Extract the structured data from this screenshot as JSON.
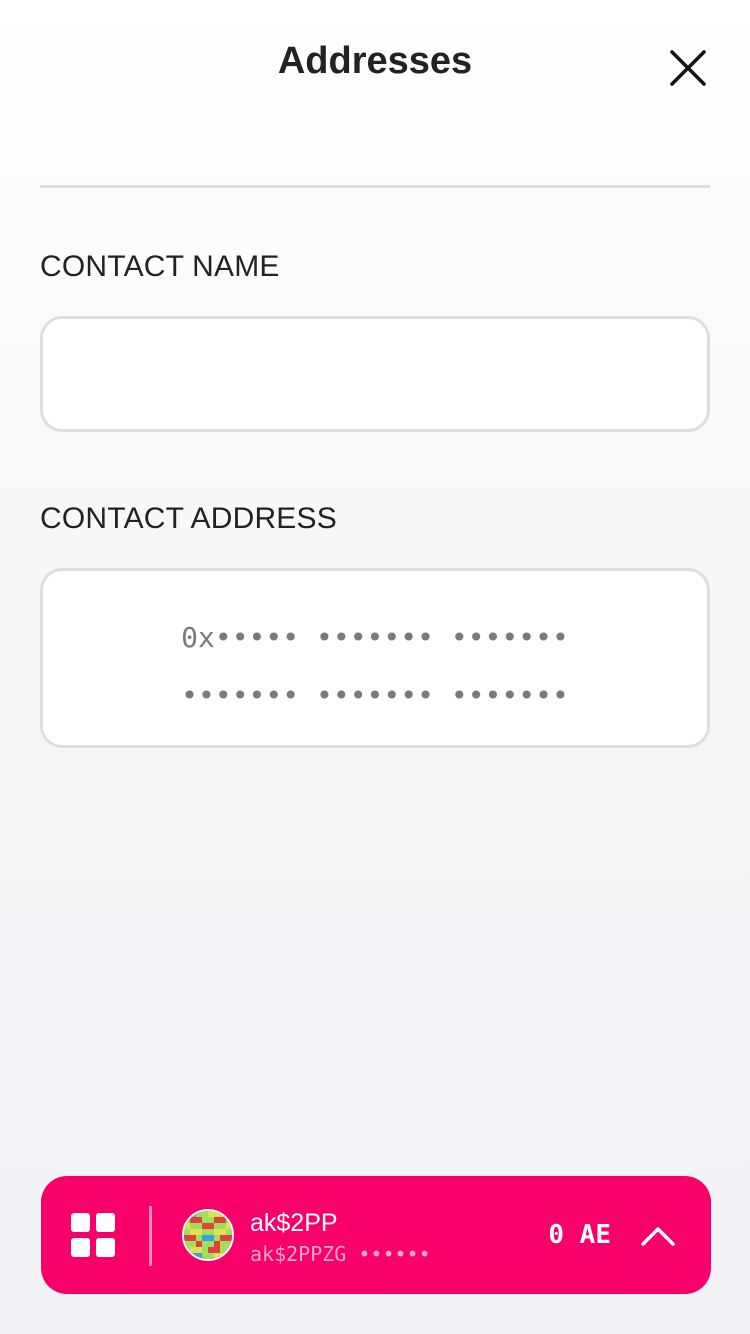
{
  "header": {
    "title": "Addresses",
    "close_icon": "close-icon"
  },
  "form": {
    "name_label": "CONTACT NAME",
    "name_value": "",
    "address_label": "CONTACT ADDRESS",
    "address_placeholder_line1": "0x••••• ••••••• •••••••",
    "address_placeholder_line2": "••••••• ••••••• •••••••"
  },
  "account_bar": {
    "apps_icon": "grid-icon",
    "account_name": "ak$2PP",
    "account_address": "ak$2PPZG ••••••",
    "balance": "0 AE",
    "expand_icon": "chevron-up-icon",
    "background_color": "#f7006a"
  }
}
